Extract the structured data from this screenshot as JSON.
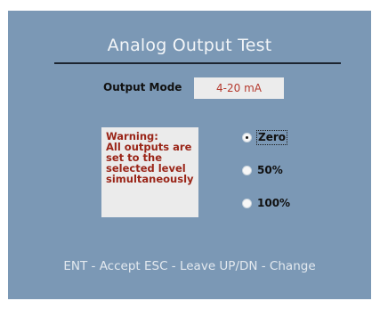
{
  "screen": {
    "title": "Analog Output Test",
    "output_mode": {
      "label": "Output Mode",
      "value": "4-20 mA"
    },
    "warning_lines": [
      "Warning:",
      "All outputs are",
      "set to the",
      "selected level",
      "simultaneously"
    ],
    "levels": [
      {
        "label": "Zero",
        "selected": true
      },
      {
        "label": "50%",
        "selected": false
      },
      {
        "label": "100%",
        "selected": false
      }
    ],
    "footer": "ENT - Accept ESC - Leave UP/DN - Change"
  },
  "colors": {
    "background": "#7b98b5",
    "warning_text": "#9a2518",
    "mode_value_text": "#b53a2e"
  }
}
